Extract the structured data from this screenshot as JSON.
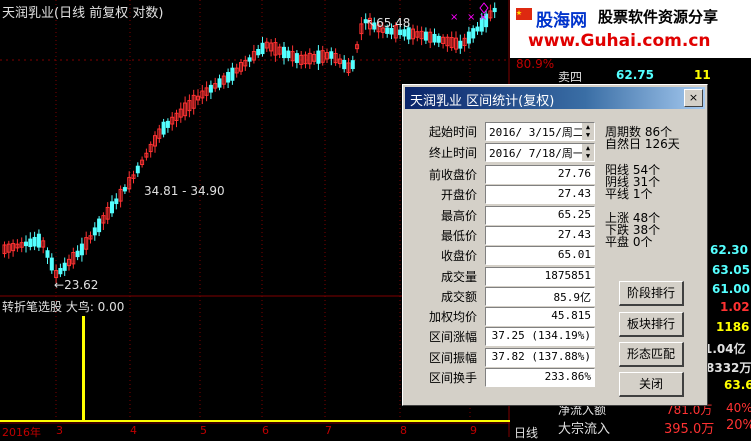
{
  "chart": {
    "title": "天润乳业(日线 前复权 对数)",
    "peak_label": "65.48",
    "range_label": "34.81 - 34.90",
    "low_label": "23.62",
    "indicator_label": "转折笔选股 大鸟: 0.00",
    "axis_year": "2016年",
    "axis_months": [
      "3",
      "4",
      "5",
      "6",
      "7",
      "8",
      "9"
    ],
    "colors": {
      "up": "#ff3232",
      "down": "#54ffff",
      "indicator": "#ffff00",
      "grid": "#800000"
    }
  },
  "banner": {
    "brand": "股海网",
    "slogan": "股票软件资源分享",
    "url": "www.Guhai.com.cn"
  },
  "right_panel": {
    "pct_label": "80.9%",
    "sell4_label": "卖四",
    "sell4_price": "62.75",
    "sell4_vol": "11",
    "right_values": [
      "62.30",
      "63.05",
      "61.00",
      "1.02",
      "1186",
      "1.04亿",
      "8332万",
      "63.6"
    ],
    "flow_rows": [
      {
        "label": "净流入额",
        "value": "781.0万",
        "pct": "40%"
      },
      {
        "label": "大宗流入",
        "value": "395.0万",
        "pct": "20%"
      }
    ],
    "bottom_tab": "日线"
  },
  "dialog": {
    "title": "天润乳业 区间统计(复权)",
    "close_icon": "×",
    "start_label": "起始时间",
    "start_value": "2016/ 3/15/周二",
    "end_label": "终止时间",
    "end_value": "2016/ 7/18/周一",
    "rows": [
      {
        "label": "前收盘价",
        "value": "27.76"
      },
      {
        "label": "开盘价",
        "value": "27.43"
      },
      {
        "label": "最高价",
        "value": "65.25"
      },
      {
        "label": "最低价",
        "value": "27.43"
      },
      {
        "label": "收盘价",
        "value": "65.01"
      },
      {
        "label": "成交量",
        "value": "1875851"
      },
      {
        "label": "成交额",
        "value": "85.9亿"
      },
      {
        "label": "加权均价",
        "value": "45.815"
      },
      {
        "label": "区间涨幅",
        "value": "37.25 (134.19%)"
      },
      {
        "label": "区间振幅",
        "value": "37.82 (137.88%)"
      },
      {
        "label": "区间换手",
        "value": "233.86%"
      }
    ],
    "stats": [
      {
        "label": "周期数",
        "value": "86个"
      },
      {
        "label": "自然日",
        "value": "126天"
      },
      {
        "label": "阳线",
        "value": "54个"
      },
      {
        "label": "阴线",
        "value": "31个"
      },
      {
        "label": "平线",
        "value": "1个"
      },
      {
        "label": "上涨",
        "value": "48个"
      },
      {
        "label": "下跌",
        "value": "38个"
      },
      {
        "label": "平盘",
        "value": "0个"
      }
    ],
    "buttons": {
      "segment_rank": "阶段排行",
      "sector_rank": "板块排行",
      "pattern_match": "形态匹配",
      "close": "关闭"
    }
  }
}
